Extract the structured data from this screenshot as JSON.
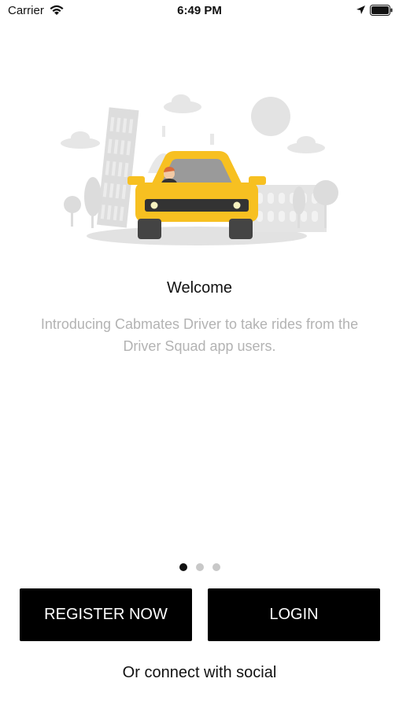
{
  "status_bar": {
    "carrier": "Carrier",
    "time": "6:49 PM"
  },
  "onboarding": {
    "title": "Welcome",
    "description": "Introducing Cabmates Driver to take rides from the Driver Squad app users.",
    "page_indicator": {
      "total": 3,
      "active": 1
    }
  },
  "actions": {
    "register_label": "REGISTER NOW",
    "login_label": "LOGIN",
    "social_text": "Or connect with social"
  },
  "colors": {
    "taxi_yellow": "#F7C021",
    "button_bg": "#000000",
    "muted_text": "#B3B3B3"
  }
}
